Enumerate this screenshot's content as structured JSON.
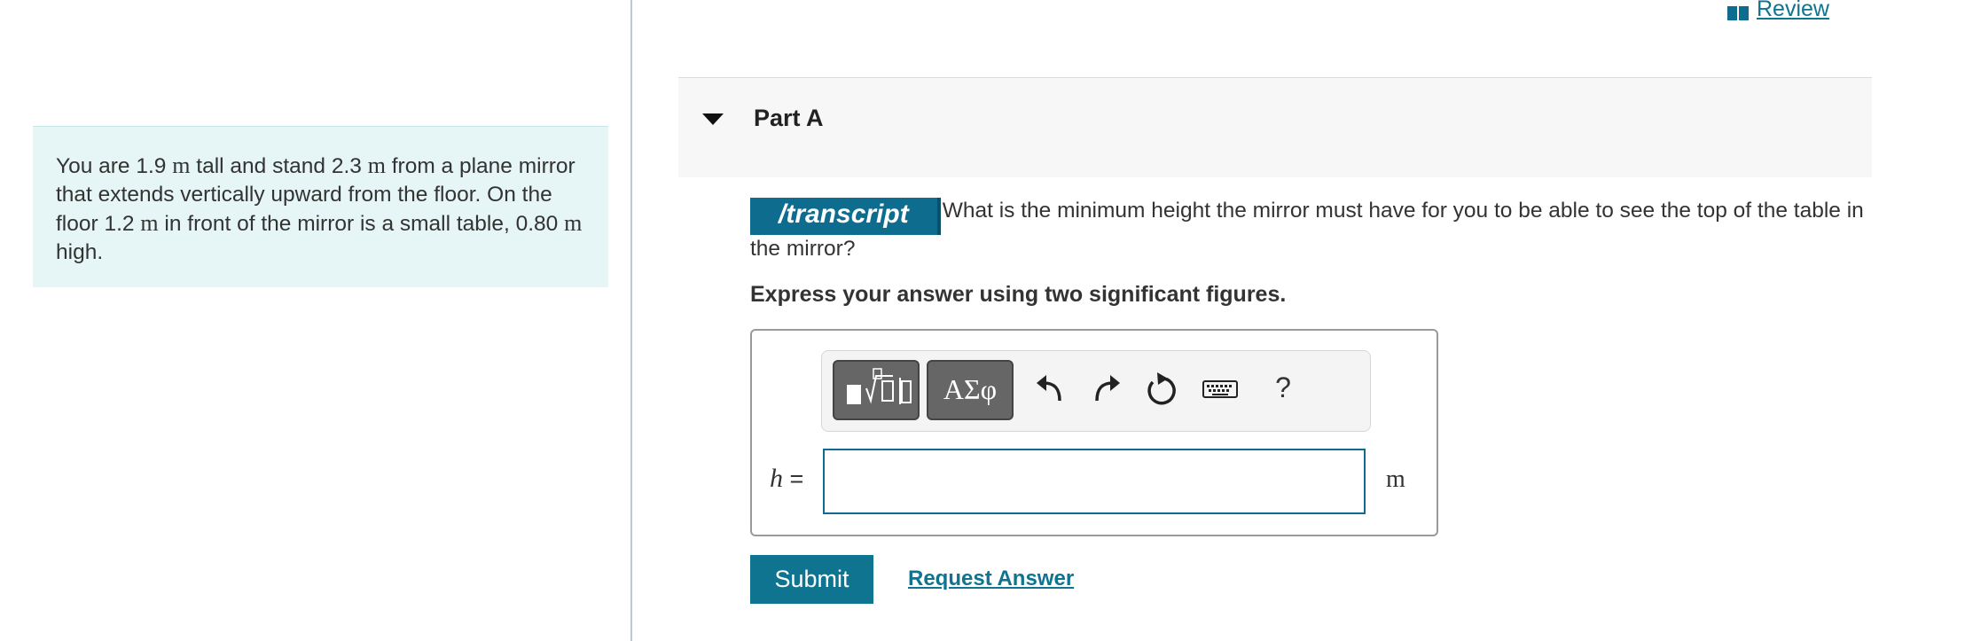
{
  "header": {
    "review_label": "Review"
  },
  "problem": {
    "s1": "You are 1.9 ",
    "u1": "m",
    "s2": " tall and stand 2.3 ",
    "u2": "m",
    "s3": " from a plane mirror that extends vertically upward from the floor. On the floor 1.2 ",
    "u3": "m",
    "s4": " in front of the mirror is a small table, 0.80 ",
    "u4": "m",
    "s5": " high."
  },
  "part": {
    "title": "Part A",
    "transcript_label": "/transcript",
    "question": "What is the minimum height the mirror must have for you to be able to see the top of the table in the mirror?",
    "instruction": "Express your answer using two significant figures."
  },
  "answer": {
    "variable": "h",
    "equals": " =",
    "value": "",
    "unit": "m",
    "symbols_label": "ΑΣφ",
    "help_label": "?"
  },
  "actions": {
    "submit_label": "Submit",
    "request_label": "Request Answer"
  },
  "colors": {
    "accent": "#0e7490",
    "problem_bg": "#e6f5f5"
  }
}
